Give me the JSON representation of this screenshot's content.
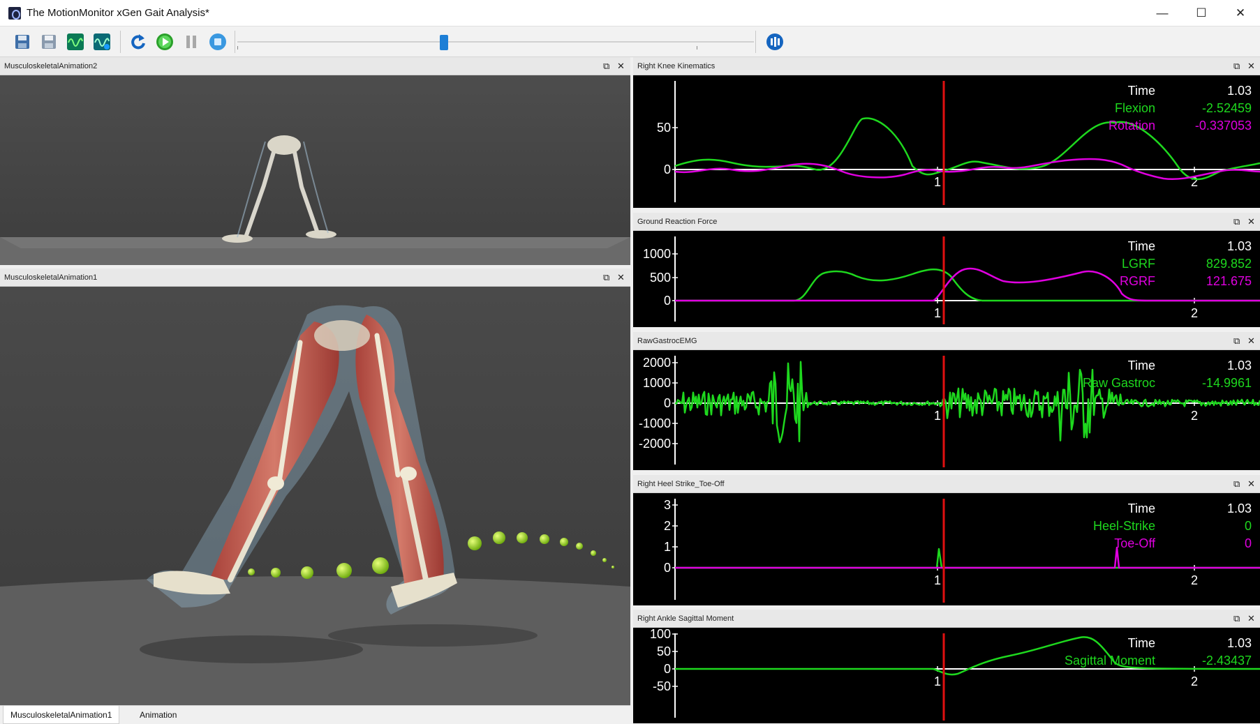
{
  "window": {
    "title": "The MotionMonitor xGen Gait Analysis*"
  },
  "window_controls": {
    "minimize": "—",
    "maximize": "☐",
    "close": "✕"
  },
  "toolbar": {
    "icons": [
      "save-icon",
      "save-as-icon",
      "waveform-green-icon",
      "waveform-teal-icon",
      "rewind-icon",
      "play-icon",
      "pause-icon",
      "stop-icon",
      "record-icon"
    ],
    "timeline_fraction": 0.4
  },
  "panels": {
    "anim2": {
      "title": "MusculoskeletalAnimation2"
    },
    "anim1": {
      "title": "MusculoskeletalAnimation1"
    },
    "knee": {
      "title": "Right Knee Kinematics",
      "yticks": [
        "50",
        "0"
      ],
      "xticks": [
        "1",
        "2"
      ],
      "readout": [
        {
          "label": "Time",
          "value": "1.03",
          "color": "#ffffff"
        },
        {
          "label": "Flexion",
          "value": "-2.52459",
          "color": "#1ed81e"
        },
        {
          "label": "Rotation",
          "value": "-0.337053",
          "color": "#e000e0"
        }
      ]
    },
    "grf": {
      "title": "Ground Reaction Force",
      "yticks": [
        "1000",
        "500",
        "0"
      ],
      "xticks": [
        "1",
        "2"
      ],
      "readout": [
        {
          "label": "Time",
          "value": "1.03",
          "color": "#ffffff"
        },
        {
          "label": "LGRF",
          "value": "829.852",
          "color": "#1ed81e"
        },
        {
          "label": "RGRF",
          "value": "121.675",
          "color": "#e000e0"
        }
      ]
    },
    "emg": {
      "title": "RawGastrocEMG",
      "yticks": [
        "2000",
        "1000",
        "0",
        "-1000",
        "-2000"
      ],
      "xticks": [
        "1",
        "2"
      ],
      "readout": [
        {
          "label": "Time",
          "value": "1.03",
          "color": "#ffffff"
        },
        {
          "label": "Raw Gastroc",
          "value": "-14.9961",
          "color": "#1ed81e"
        }
      ]
    },
    "heel": {
      "title": "Right Heel Strike_Toe-Off",
      "yticks": [
        "3",
        "2",
        "1",
        "0"
      ],
      "xticks": [
        "1",
        "2"
      ],
      "readout": [
        {
          "label": "Time",
          "value": "1.03",
          "color": "#ffffff"
        },
        {
          "label": "Heel-Strike",
          "value": "0",
          "color": "#1ed81e"
        },
        {
          "label": "Toe-Off",
          "value": "0",
          "color": "#e000e0"
        }
      ]
    },
    "ankle": {
      "title": "Right Ankle Sagittal Moment",
      "yticks": [
        "100",
        "50",
        "0",
        "-50"
      ],
      "xticks": [
        "1",
        "2"
      ],
      "readout": [
        {
          "label": "Time",
          "value": "1.03",
          "color": "#ffffff"
        },
        {
          "label": "Sagittal Moment",
          "value": "-2.43437",
          "color": "#1ed81e"
        }
      ]
    }
  },
  "bottom_tabs": [
    {
      "label": "MusculoskeletalAnimation1",
      "active": true
    },
    {
      "label": "Animation",
      "active": false
    }
  ],
  "colors": {
    "accent": "#1e7fd6",
    "green": "#1ed81e",
    "magenta": "#e000e0",
    "cursor": "#e01010"
  }
}
